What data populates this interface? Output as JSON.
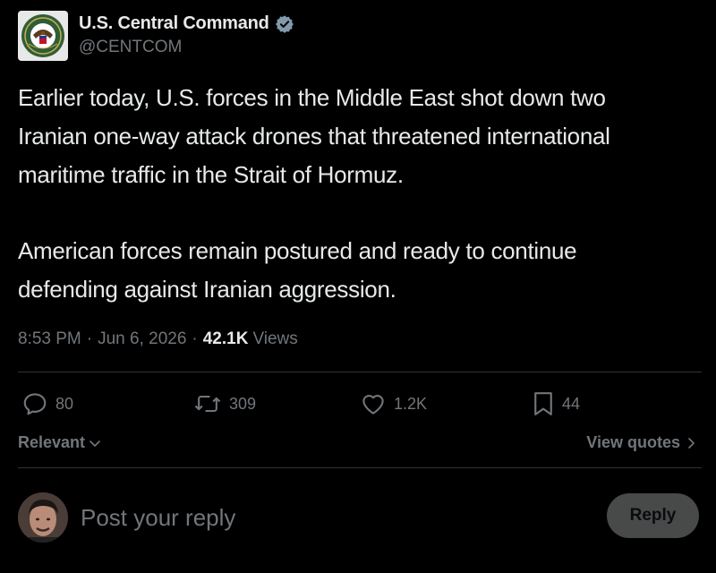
{
  "account": {
    "display_name": "U.S. Central Command",
    "handle": "@CENTCOM",
    "verified": true,
    "avatar_icon": "department-of-defense-seal-icon"
  },
  "post": {
    "paragraphs": [
      "Earlier today, U.S. forces in the Middle East shot down two\nIranian one-way attack drones that threatened international\nmaritime traffic in the Strait of Hormuz.",
      "American forces remain postured and ready to continue\ndefending against Iranian aggression."
    ],
    "time": "8:53 PM",
    "separator": "·",
    "date": "Jun 6, 2026",
    "views_count": "42.1K",
    "views_label": "Views"
  },
  "actions": {
    "replies": "80",
    "reposts": "309",
    "likes": "1.2K",
    "bookmarks": "44"
  },
  "sort": {
    "label": "Relevant",
    "icon": "chevron-down-icon"
  },
  "view_quotes": {
    "label": "View quotes",
    "icon": "chevron-right-icon"
  },
  "reply_box": {
    "placeholder": "Post your reply",
    "button_label": "Reply"
  },
  "colors": {
    "background": "#000000",
    "text_primary": "#e7e9ea",
    "text_secondary": "#71767b",
    "divider": "#2f3336",
    "verified_badge": "#829aab",
    "reply_button": "#787a7a"
  }
}
